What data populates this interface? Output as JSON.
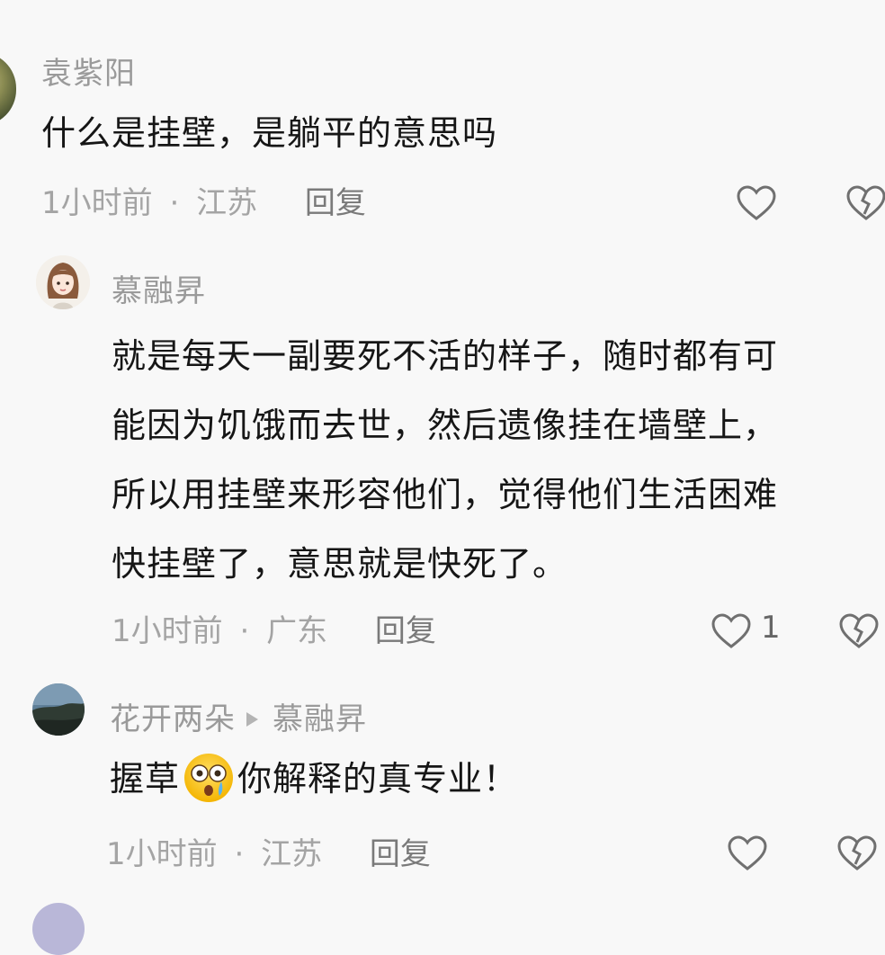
{
  "comments": [
    {
      "username": "袁紫阳",
      "text": "什么是挂壁，是躺平的意思吗",
      "time": "1小时前",
      "sep": "·",
      "location": "江苏",
      "reply_label": "回复",
      "likes": ""
    },
    {
      "username": "慕融昇",
      "lines": [
        "就是每天一副要死不活的样子，随时都有可",
        "能因为饥饿而去世，然后遗像挂在墙壁上，",
        "所以用挂壁来形容他们，觉得他们生活困难",
        "快挂壁了，意思就是快死了。"
      ],
      "time": "1小时前",
      "sep": "·",
      "location": "广东",
      "reply_label": "回复",
      "likes": "1"
    },
    {
      "username": "花开两朵",
      "reply_to": "慕融昇",
      "text_before": "握草",
      "emoji": "shocked-crying-emoji",
      "text_after": "你解释的真专业！",
      "time": "1小时前",
      "sep": "·",
      "location": "江苏",
      "reply_label": "回复",
      "likes": ""
    }
  ],
  "colors": {
    "background": "#f8f8f8",
    "username": "#9a9a9a",
    "text": "#161616",
    "meta": "#a4a4a4",
    "icon": "#707070"
  }
}
